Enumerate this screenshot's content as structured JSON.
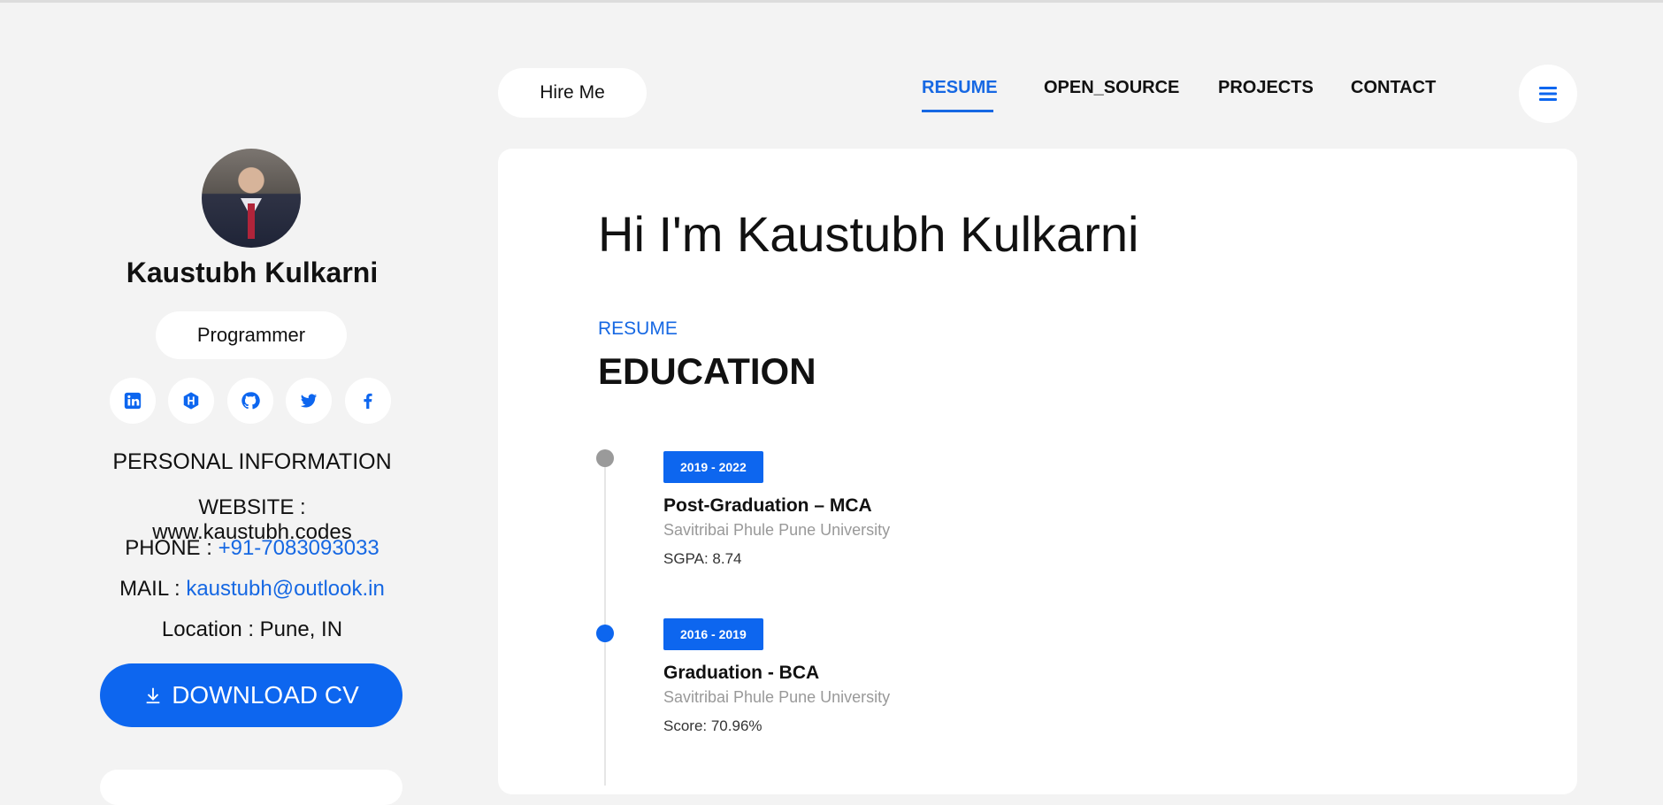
{
  "nav": {
    "hire_label": "Hire Me",
    "items": [
      "RESUME",
      "OPEN_SOURCE",
      "PROJECTS",
      "CONTACT"
    ],
    "active": "RESUME"
  },
  "profile": {
    "name": "Kaustubh Kulkarni",
    "role": "Programmer",
    "socials": [
      "linkedin-icon",
      "hashnode-icon",
      "github-icon",
      "twitter-icon",
      "facebook-icon"
    ]
  },
  "personal_info": {
    "title": "PERSONAL INFORMATION",
    "website_label": "WEBSITE : ",
    "website": "www.kaustubh.codes",
    "phone_label": "PHONE : ",
    "phone": "+91-7083093033",
    "mail_label": "MAIL : ",
    "mail": "kaustubh@outlook.in",
    "location_label": "Location : ",
    "location": "Pune, IN"
  },
  "download_cv": "DOWNLOAD CV",
  "main": {
    "greeting": "Hi I'm Kaustubh Kulkarni",
    "kicker": "RESUME",
    "section_title": "EDUCATION",
    "education": [
      {
        "dates": "2019 - 2022",
        "degree": "Post-Graduation – MCA",
        "university": "Savitribai Phule Pune University",
        "score": "SGPA: 8.74"
      },
      {
        "dates": "2016 - 2019",
        "degree": "Graduation - BCA",
        "university": "Savitribai Phule Pune University",
        "score": "Score: 70.96%"
      }
    ]
  },
  "colors": {
    "accent": "#0d66ef",
    "background": "#f3f3f3",
    "card": "#ffffff"
  }
}
